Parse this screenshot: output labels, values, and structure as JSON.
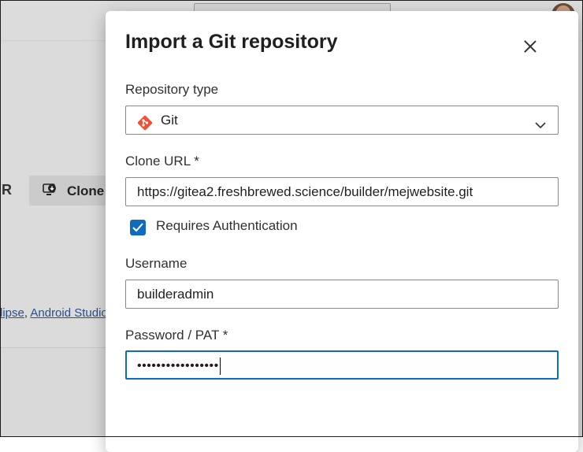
{
  "background": {
    "partial_heading_letter": "R",
    "clone_button_label": "Clone",
    "ide_links": [
      "lipse",
      "Android Studio"
    ],
    "ide_links_separator": ", "
  },
  "dialog": {
    "title": "Import a Git repository",
    "repository_type": {
      "label": "Repository type",
      "value": "Git",
      "icon": "git-icon"
    },
    "clone_url": {
      "label": "Clone URL *",
      "value": "https://gitea2.freshbrewed.science/builder/mejwebsite.git"
    },
    "requires_authentication": {
      "label": "Requires Authentication",
      "checked": true
    },
    "username": {
      "label": "Username",
      "value": "builderadmin"
    },
    "password": {
      "label": "Password / PAT *",
      "masked_value": "•••••••••••••••••"
    }
  },
  "colors": {
    "accent": "#0f6cbd",
    "git_brand": "#f05133"
  }
}
